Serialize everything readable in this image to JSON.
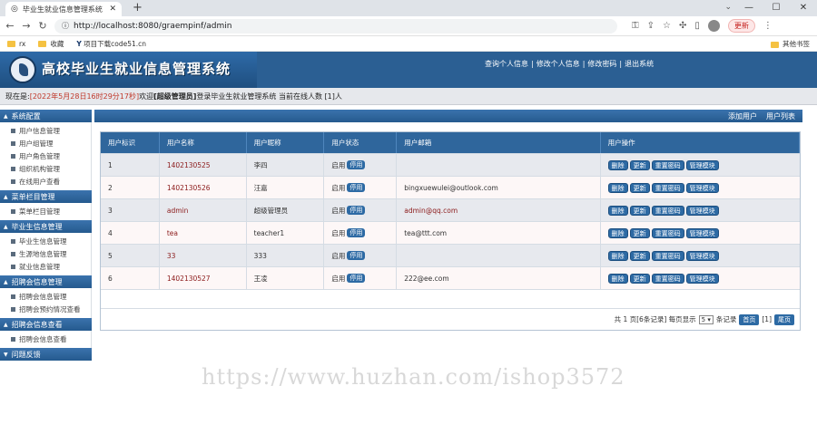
{
  "browser": {
    "tab_title": "毕业生就业信息管理系统",
    "url": "http://localhost:8080/graempinf/admin",
    "update_label": "更新",
    "bookmarks": [
      "rx",
      "收藏",
      "项目下载code51.cn"
    ],
    "bookmarks_right": "其他书签"
  },
  "header": {
    "title": "高校毕业生就业信息管理系统",
    "links": [
      "查询个人信息",
      "修改个人信息",
      "修改密码",
      "退出系统"
    ]
  },
  "status": {
    "prefix": "现在是:",
    "time": "[2022年5月28日16时29分17秒]",
    "welcome": " 欢迎",
    "role": "[超级管理员]",
    "suffix": "登录毕业生就业管理系统 当前在线人数 [1]人"
  },
  "sidebar": {
    "groups": [
      {
        "title": "系统配置",
        "items": [
          "用户信息管理",
          "用户组管理",
          "用户角色管理",
          "组织机构管理",
          "在线用户查看"
        ]
      },
      {
        "title": "菜单栏目管理",
        "items": [
          "菜单栏目管理"
        ]
      },
      {
        "title": "毕业生信息管理",
        "items": [
          "毕业生信息管理",
          "生源地信息管理",
          "就业信息管理"
        ]
      },
      {
        "title": "招聘会信息管理",
        "items": [
          "招聘会信息管理",
          "招聘会预约情况查看"
        ]
      },
      {
        "title": "招聘会信息查看",
        "items": [
          "招聘会信息查看"
        ]
      },
      {
        "title": "问题反馈",
        "items": []
      }
    ]
  },
  "content": {
    "actions": [
      "添加用户",
      "用户列表"
    ],
    "columns": [
      "用户标识",
      "用户名称",
      "用户昵称",
      "用户状态",
      "用户邮箱",
      "用户操作"
    ],
    "status_text": "启用",
    "disable_label": "停用",
    "op_labels": [
      "删除",
      "更新",
      "重置密码",
      "管理模块"
    ],
    "rows": [
      {
        "id": "1",
        "name": "1402130525",
        "nick": "李四",
        "email": ""
      },
      {
        "id": "2",
        "name": "1402130526",
        "nick": "汪嘉",
        "email": "bingxuewulei@outlook.com"
      },
      {
        "id": "3",
        "name": "admin",
        "nick": "超级管理员",
        "email": "admin@qq.com"
      },
      {
        "id": "4",
        "name": "tea",
        "nick": "teacher1",
        "email": "tea@ttt.com"
      },
      {
        "id": "5",
        "name": "33",
        "nick": "333",
        "email": ""
      },
      {
        "id": "6",
        "name": "1402130527",
        "nick": "王凌",
        "email": "222@ee.com"
      }
    ],
    "pager": {
      "summary": "共 1 页[6条记录] 每页显示",
      "per_page": "5",
      "unit": "条记录",
      "first": "首页",
      "current": "[1]",
      "last": "尾页"
    }
  },
  "watermark": "https://www.huzhan.com/ishop3572"
}
